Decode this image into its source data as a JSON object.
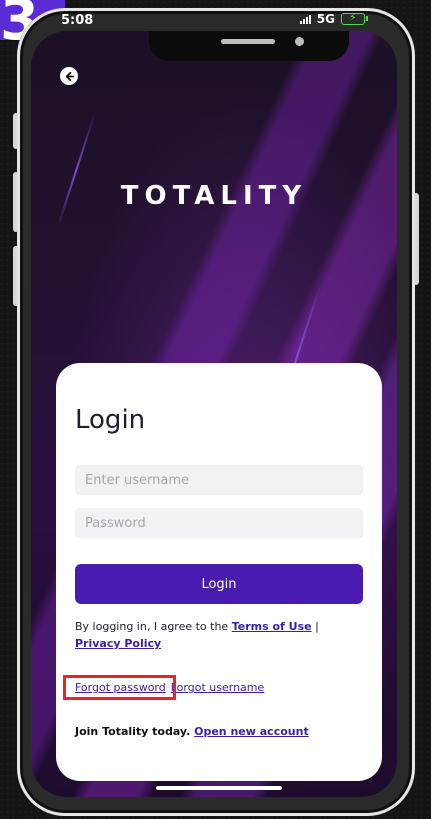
{
  "step": {
    "number": "3"
  },
  "status_bar": {
    "time": "5:08",
    "network": "5G",
    "icons": [
      "signal-icon",
      "battery-charging-icon"
    ]
  },
  "header": {
    "back_icon": "arrow-left-icon",
    "brand": "TOTALITY"
  },
  "login_card": {
    "title": "Login",
    "username_placeholder": "Enter username",
    "username_value": "",
    "password_placeholder": "Password",
    "password_value": "",
    "login_button": "Login",
    "terms_prefix": "By logging in, I agree to the ",
    "terms_link": "Terms of Use",
    "terms_separator": " | ",
    "privacy_link": "Privacy Policy",
    "forgot_password": "Forgot password",
    "forgot_username": "Forgot username",
    "join_text": "Join Totality today.",
    "open_account_link": "Open new account"
  },
  "colors": {
    "accent": "#4a1bb0",
    "step_badge": "#5b2bd6",
    "highlight": "#e8262a",
    "link": "#3a1fa8"
  }
}
